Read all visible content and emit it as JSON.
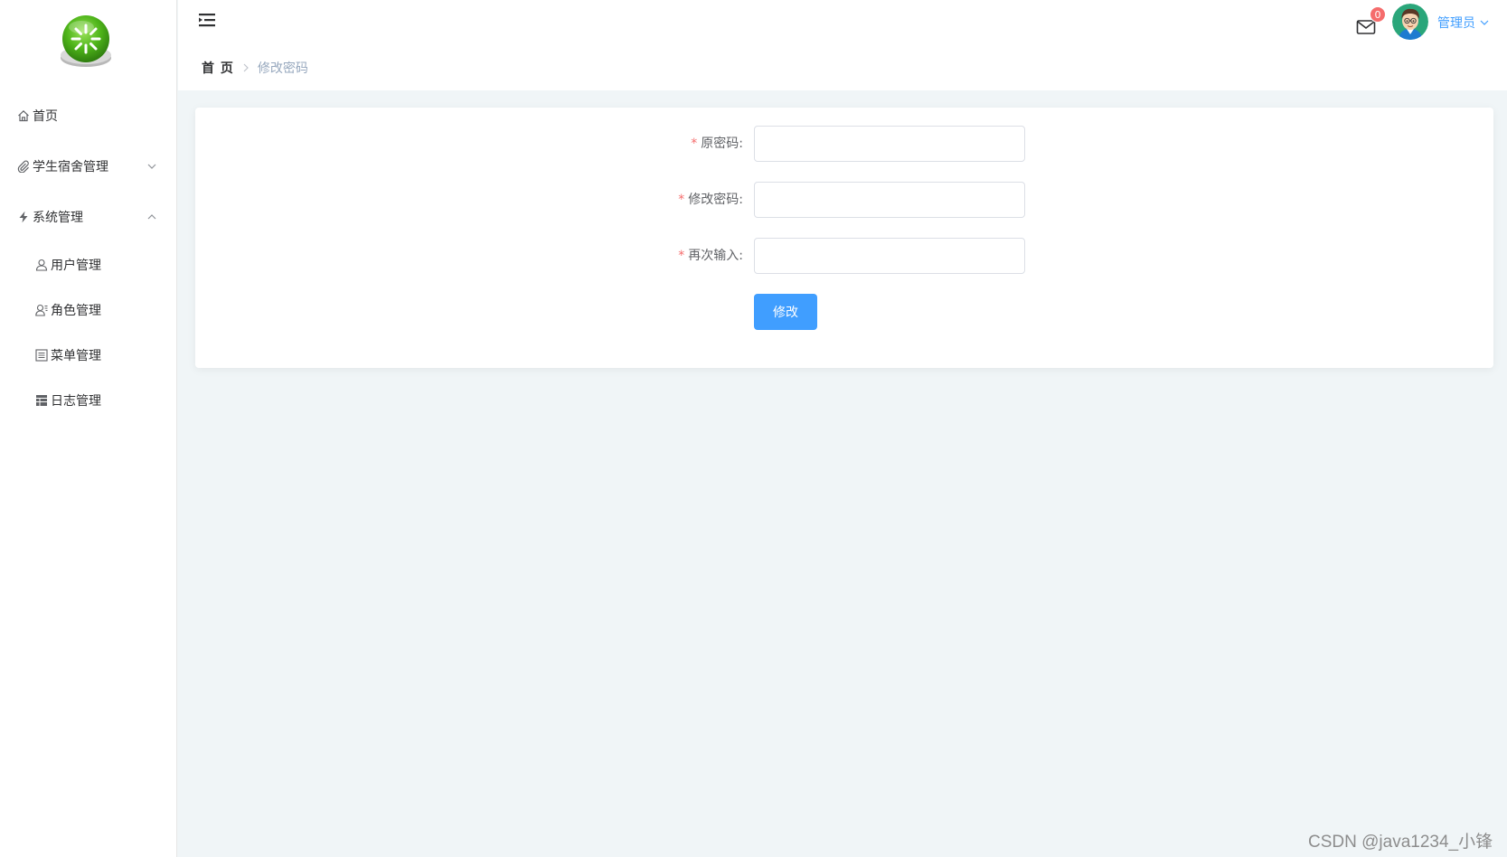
{
  "sidebar": {
    "logo": "green-asterisk-button-logo",
    "items": [
      {
        "label": "首页",
        "icon": "home-icon"
      },
      {
        "label": "学生宿舍管理",
        "icon": "paperclip-icon",
        "expandable": true,
        "expanded": false
      },
      {
        "label": "系统管理",
        "icon": "lightning-icon",
        "expandable": true,
        "expanded": true,
        "children": [
          {
            "label": "用户管理",
            "icon": "user-icon"
          },
          {
            "label": "角色管理",
            "icon": "user-role-icon"
          },
          {
            "label": "菜单管理",
            "icon": "list-icon"
          },
          {
            "label": "日志管理",
            "icon": "table-icon"
          }
        ]
      }
    ]
  },
  "header": {
    "breadcrumb": {
      "home": "首 页",
      "current": "修改密码"
    },
    "messages": {
      "count": "0",
      "icon": "mail-icon"
    },
    "user": {
      "name": "管理员",
      "avatar": "avatar-cartoon-man"
    }
  },
  "form": {
    "fields": [
      {
        "label": "原密码:",
        "value": ""
      },
      {
        "label": "修改密码:",
        "value": ""
      },
      {
        "label": "再次输入:",
        "value": ""
      }
    ],
    "submit_label": "修改"
  },
  "watermark": "CSDN @java1234_小锋",
  "colors": {
    "primary": "#409eff",
    "required": "#f56c6c",
    "page_bg": "#f0f5f7",
    "logo_green": "#5cc21e"
  }
}
